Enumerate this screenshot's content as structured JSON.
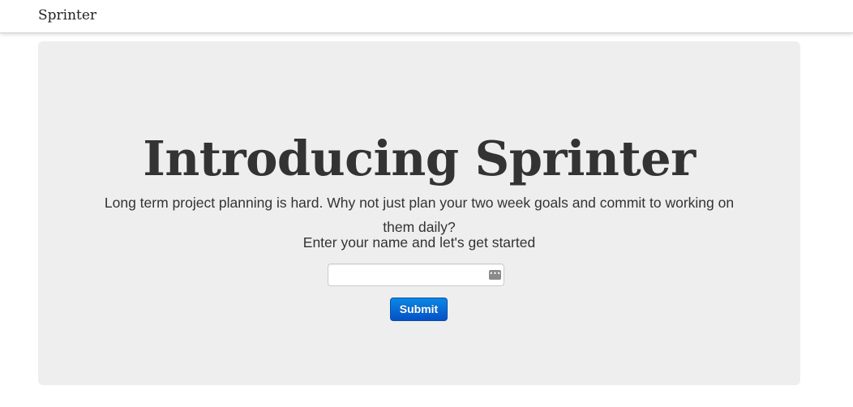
{
  "navbar": {
    "brand": "Sprinter"
  },
  "hero": {
    "title": "Introducing Sprinter",
    "description": "Long term project planning is hard. Why not just plan your two week goals and commit to working on them daily?",
    "prompt": "Enter your name and let's get started",
    "name_input": {
      "value": "",
      "placeholder": ""
    },
    "submit_label": "Submit",
    "input_icon": "password-manager-icon"
  },
  "colors": {
    "hero_background": "#eeeeee",
    "button": "#0a75d8",
    "text": "#333333"
  }
}
